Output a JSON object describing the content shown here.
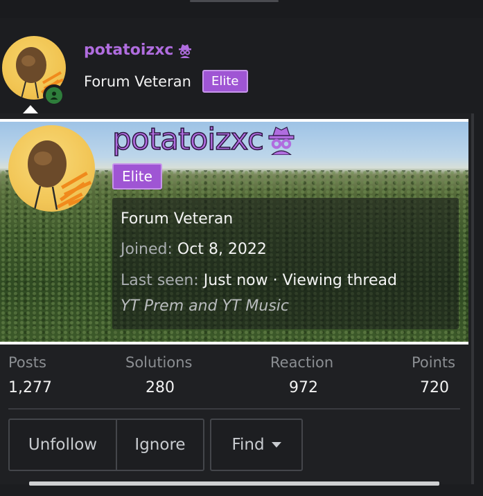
{
  "header": {
    "username": "potatoizxc",
    "title": "Forum Veteran",
    "badge": "Elite",
    "online_icon": "user-online-icon",
    "user_icon": "spy-icon"
  },
  "card": {
    "username": "potatoizxc",
    "badge": "Elite",
    "title": "Forum Veteran",
    "joined_label": "Joined:",
    "joined_value": "Oct 8, 2022",
    "last_seen_label": "Last seen:",
    "last_seen_value": "Just now",
    "separator": "·",
    "activity": "Viewing thread",
    "thread_title": "YT Prem and YT Music"
  },
  "stats": [
    {
      "label": "Posts",
      "value": "1,277"
    },
    {
      "label": "Solutions",
      "value": "280"
    },
    {
      "label": "Reaction",
      "value": "972"
    },
    {
      "label": "Points",
      "value": "720"
    }
  ],
  "buttons": {
    "unfollow": "Unfollow",
    "ignore": "Ignore",
    "find": "Find"
  },
  "colors": {
    "username": "#b06ddf",
    "badge_bg": "#9f55d4",
    "online": "#2e7d3b"
  }
}
